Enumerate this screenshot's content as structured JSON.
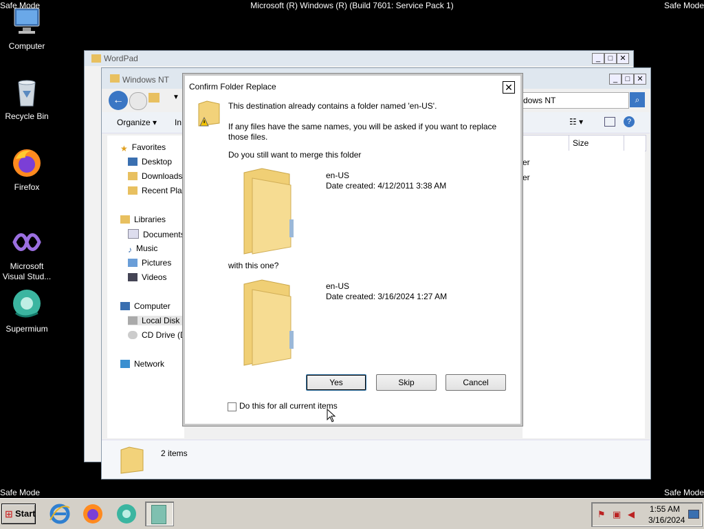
{
  "screen": {
    "safe_mode": "Safe Mode",
    "build_text": "Microsoft (R) Windows (R) (Build 7601: Service Pack 1)"
  },
  "desktop_icons": [
    {
      "label": "Computer",
      "icon": "computer-icon"
    },
    {
      "label": "Recycle Bin",
      "icon": "recycle-bin-icon"
    },
    {
      "label": "Firefox",
      "icon": "firefox-icon"
    },
    {
      "label": "Microsoft Visual Stud...",
      "icon": "visual-studio-icon"
    },
    {
      "label": "Supermium",
      "icon": "supermium-icon"
    }
  ],
  "wordpad_window": {
    "title": "WordPad"
  },
  "explorer": {
    "title": "Windows NT",
    "address_tail": "dows NT",
    "toolbar": {
      "organize": "Organize",
      "include": "In"
    },
    "columns": {
      "size": "Size"
    },
    "row_fragments": [
      "er",
      "er"
    ],
    "nav": {
      "favorites": "Favorites",
      "desktop": "Desktop",
      "downloads": "Downloads",
      "recent": "Recent Plac",
      "libraries": "Libraries",
      "documents": "Documents",
      "music": "Music",
      "pictures": "Pictures",
      "videos": "Videos",
      "computer": "Computer",
      "local_disk": "Local Disk (",
      "cd_drive": "CD Drive (D",
      "network": "Network"
    },
    "status": "2 items"
  },
  "dialog": {
    "title": "Confirm Folder Replace",
    "close": "✕",
    "line1": "This destination already contains a folder named 'en-US'.",
    "line2a": "If any files have the same names, you will be asked if you want to replace",
    "line2b": "those files.",
    "question": "Do you still want to merge this folder",
    "existing": {
      "name": "en-US",
      "date": "Date created: 4/12/2011 3:38 AM"
    },
    "with_this": "with this one?",
    "incoming": {
      "name": "en-US",
      "date": "Date created: 3/16/2024 1:27 AM"
    },
    "buttons": {
      "yes": "Yes",
      "skip": "Skip",
      "cancel": "Cancel"
    },
    "checkbox_label": "Do this for all current items",
    "checkbox_checked": false
  },
  "taskbar": {
    "start": "Start",
    "pinned": [
      "internet-explorer-icon",
      "firefox-icon",
      "supermium-icon",
      "explorer-window-icon"
    ],
    "clock_time": "1:55 AM",
    "clock_date": "3/16/2024"
  }
}
